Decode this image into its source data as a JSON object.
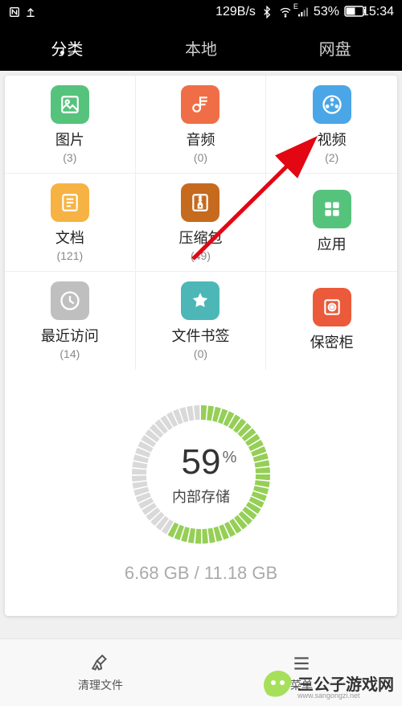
{
  "status_bar": {
    "data_rate": "129B/s",
    "battery_pct": "53%",
    "time": "15:34"
  },
  "tabs": [
    {
      "label": "分类",
      "active": true
    },
    {
      "label": "本地",
      "active": false
    },
    {
      "label": "网盘",
      "active": false
    }
  ],
  "categories": [
    {
      "icon": "pic",
      "label": "图片",
      "count": "(3)"
    },
    {
      "icon": "audio",
      "label": "音频",
      "count": "(0)"
    },
    {
      "icon": "video",
      "label": "视频",
      "count": "(2)"
    },
    {
      "icon": "doc",
      "label": "文档",
      "count": "(121)"
    },
    {
      "icon": "zip",
      "label": "压缩包",
      "count": "(49)"
    },
    {
      "icon": "app",
      "label": "应用",
      "count": ""
    },
    {
      "icon": "recent",
      "label": "最近访问",
      "count": "(14)"
    },
    {
      "icon": "bookmark",
      "label": "文件书签",
      "count": "(0)"
    },
    {
      "icon": "safe",
      "label": "保密柜",
      "count": ""
    }
  ],
  "storage": {
    "percent": "59",
    "percent_symbol": "%",
    "label": "内部存储",
    "text": "6.68 GB / 11.18 GB",
    "ratio": 0.59
  },
  "bottom": {
    "clean": "清理文件",
    "menu": "菜单"
  },
  "watermark": {
    "title": "三公子游戏网",
    "sub": "www.sangongzi.net"
  },
  "colors": {
    "accent_green": "#95cf56",
    "grey_ring": "#d9d9d9"
  }
}
